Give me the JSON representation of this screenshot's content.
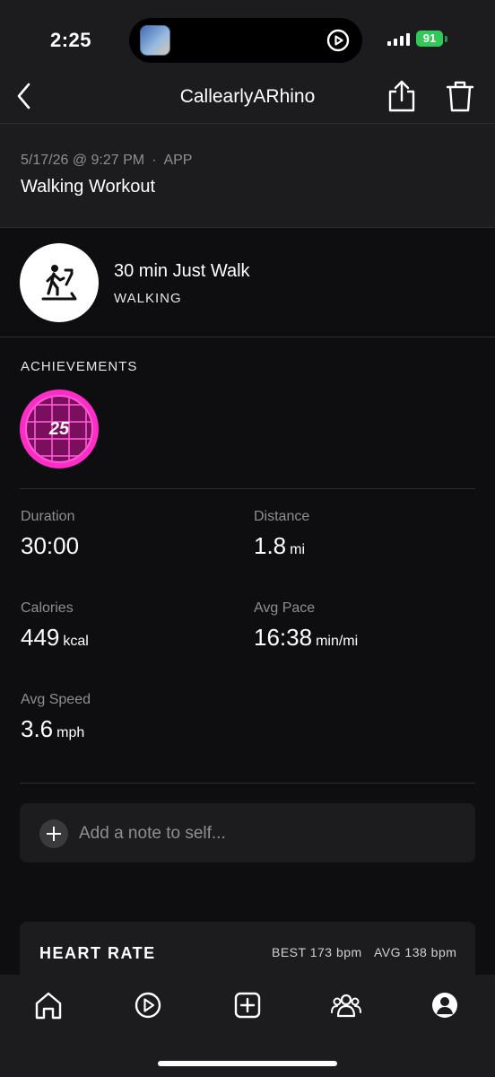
{
  "status_bar": {
    "time": "2:25",
    "battery": "91"
  },
  "nav": {
    "title": "CallearlyARhino"
  },
  "workout": {
    "date": "5/17/26 @ 9:27 PM",
    "source": "APP",
    "name": "Walking Workout"
  },
  "class": {
    "title": "30 min Just Walk",
    "type": "WALKING",
    "icon": "treadmill-walker-icon"
  },
  "achievements": {
    "label": "ACHIEVEMENTS",
    "badges": [
      {
        "number": "25",
        "color": "#ff2dc8"
      }
    ]
  },
  "stats": {
    "duration": {
      "label": "Duration",
      "value": "30:00",
      "unit": ""
    },
    "distance": {
      "label": "Distance",
      "value": "1.8",
      "unit": "mi"
    },
    "calories": {
      "label": "Calories",
      "value": "449",
      "unit": "kcal"
    },
    "avg_pace": {
      "label": "Avg Pace",
      "value": "16:38",
      "unit": "min/mi"
    },
    "avg_speed": {
      "label": "Avg Speed",
      "value": "3.6",
      "unit": "mph"
    }
  },
  "note": {
    "placeholder": "Add a note to self..."
  },
  "heart_rate": {
    "title": "HEART RATE",
    "best": "BEST 173 bpm",
    "avg": "AVG 138 bpm"
  },
  "tabs": [
    {
      "name": "home",
      "icon": "home-icon"
    },
    {
      "name": "classes",
      "icon": "play-circle-icon"
    },
    {
      "name": "add",
      "icon": "plus-square-icon"
    },
    {
      "name": "community",
      "icon": "people-icon"
    },
    {
      "name": "profile",
      "icon": "profile-icon"
    }
  ],
  "colors": {
    "background": "#0e0e10",
    "surface": "#1c1c1e",
    "badge": "#ff2dc8",
    "battery": "#34c759"
  }
}
